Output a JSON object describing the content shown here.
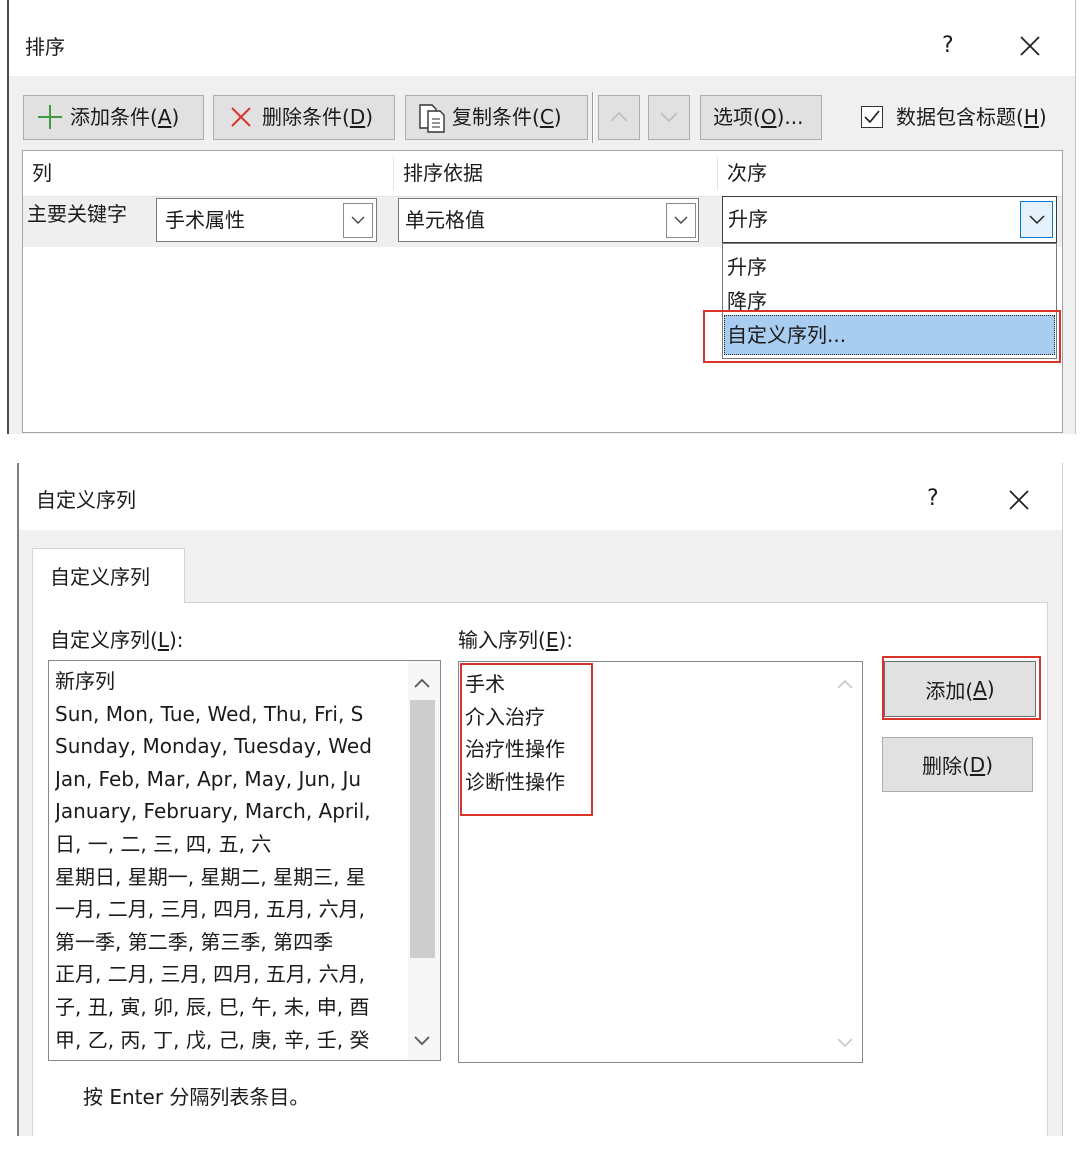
{
  "sort_dialog": {
    "title": "排序",
    "help_label": "?",
    "toolbar": {
      "add_label": "添加条件(A)",
      "delete_label": "删除条件(D)",
      "copy_label": "复制条件(C)",
      "options_label": "选项(O)...",
      "has_headers_label": "数据包含标题(H)",
      "has_headers_checked": true
    },
    "headers": {
      "column": "列",
      "sort_on": "排序依据",
      "order": "次序"
    },
    "level": {
      "label": "主要关键字",
      "column": "手术属性",
      "sort_on": "单元格值",
      "order": "升序"
    },
    "order_dropdown": {
      "open": true,
      "options": [
        "升序",
        "降序",
        "自定义序列..."
      ],
      "highlighted_index": 2
    }
  },
  "custom_lists_dialog": {
    "title": "自定义序列",
    "help_label": "?",
    "tab_label": "自定义序列",
    "lists_label": "自定义序列(L):",
    "lists": [
      "新序列",
      "Sun, Mon, Tue, Wed, Thu, Fri, S",
      "Sunday, Monday, Tuesday, Wed",
      "Jan, Feb, Mar, Apr, May, Jun, Ju",
      "January, February, March, April,",
      "日, 一, 二, 三, 四, 五, 六",
      "星期日, 星期一, 星期二, 星期三, 星",
      "一月, 二月, 三月, 四月, 五月, 六月,",
      "第一季, 第二季, 第三季, 第四季",
      "正月, 二月, 三月, 四月, 五月, 六月,",
      "子, 丑, 寅, 卯, 辰, 巳, 午, 未, 申, 酉",
      "甲, 乙, 丙, 丁, 戊, 己, 庚, 辛, 壬, 癸"
    ],
    "entries_label": "输入序列(E):",
    "entries": [
      "手术",
      "介入治疗",
      "治疗性操作",
      "诊断性操作"
    ],
    "add_button": "添加(A)",
    "delete_button": "删除(D)",
    "hint": "按 Enter 分隔列表条目。"
  },
  "icons": {
    "add": "plus-icon",
    "delete": "x-icon",
    "copy": "copy-icon",
    "move_up": "chevron-up-icon",
    "move_down": "chevron-down-icon",
    "dropdown": "chevron-down-icon",
    "checkbox": "check-icon",
    "close": "close-icon"
  },
  "colors": {
    "annotation": "#d9342b",
    "selection": "#a9cdf0",
    "focus": "#0078d7",
    "add_icon": "#3f9b3f",
    "delete_icon": "#d9342b"
  }
}
